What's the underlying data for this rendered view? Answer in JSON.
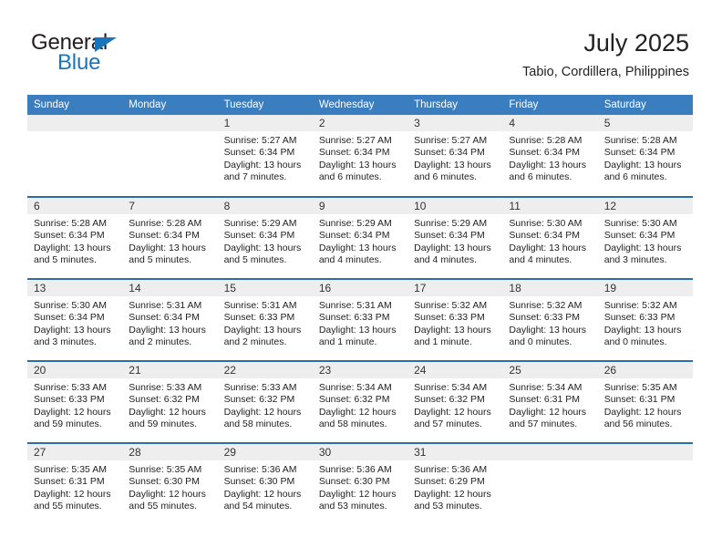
{
  "brand": {
    "name_part1": "General",
    "name_part2": "Blue",
    "logo_icon": "triangle-logo-icon",
    "accent_color": "#1b75bc"
  },
  "header": {
    "title": "July 2025",
    "subtitle": "Tabio, Cordillera, Philippines"
  },
  "theme": {
    "header_bar_color": "#3a7ebf",
    "row_divider_color": "#2e6da4",
    "daynum_band_color": "#eeeeee"
  },
  "weekdays": [
    "Sunday",
    "Monday",
    "Tuesday",
    "Wednesday",
    "Thursday",
    "Friday",
    "Saturday"
  ],
  "weeks": [
    [
      {
        "day": "",
        "sunrise": "",
        "sunset": "",
        "daylight1": "",
        "daylight2": "",
        "empty": true
      },
      {
        "day": "",
        "sunrise": "",
        "sunset": "",
        "daylight1": "",
        "daylight2": "",
        "empty": true
      },
      {
        "day": "1",
        "sunrise": "Sunrise: 5:27 AM",
        "sunset": "Sunset: 6:34 PM",
        "daylight1": "Daylight: 13 hours",
        "daylight2": "and 7 minutes."
      },
      {
        "day": "2",
        "sunrise": "Sunrise: 5:27 AM",
        "sunset": "Sunset: 6:34 PM",
        "daylight1": "Daylight: 13 hours",
        "daylight2": "and 6 minutes."
      },
      {
        "day": "3",
        "sunrise": "Sunrise: 5:27 AM",
        "sunset": "Sunset: 6:34 PM",
        "daylight1": "Daylight: 13 hours",
        "daylight2": "and 6 minutes."
      },
      {
        "day": "4",
        "sunrise": "Sunrise: 5:28 AM",
        "sunset": "Sunset: 6:34 PM",
        "daylight1": "Daylight: 13 hours",
        "daylight2": "and 6 minutes."
      },
      {
        "day": "5",
        "sunrise": "Sunrise: 5:28 AM",
        "sunset": "Sunset: 6:34 PM",
        "daylight1": "Daylight: 13 hours",
        "daylight2": "and 6 minutes."
      }
    ],
    [
      {
        "day": "6",
        "sunrise": "Sunrise: 5:28 AM",
        "sunset": "Sunset: 6:34 PM",
        "daylight1": "Daylight: 13 hours",
        "daylight2": "and 5 minutes."
      },
      {
        "day": "7",
        "sunrise": "Sunrise: 5:28 AM",
        "sunset": "Sunset: 6:34 PM",
        "daylight1": "Daylight: 13 hours",
        "daylight2": "and 5 minutes."
      },
      {
        "day": "8",
        "sunrise": "Sunrise: 5:29 AM",
        "sunset": "Sunset: 6:34 PM",
        "daylight1": "Daylight: 13 hours",
        "daylight2": "and 5 minutes."
      },
      {
        "day": "9",
        "sunrise": "Sunrise: 5:29 AM",
        "sunset": "Sunset: 6:34 PM",
        "daylight1": "Daylight: 13 hours",
        "daylight2": "and 4 minutes."
      },
      {
        "day": "10",
        "sunrise": "Sunrise: 5:29 AM",
        "sunset": "Sunset: 6:34 PM",
        "daylight1": "Daylight: 13 hours",
        "daylight2": "and 4 minutes."
      },
      {
        "day": "11",
        "sunrise": "Sunrise: 5:30 AM",
        "sunset": "Sunset: 6:34 PM",
        "daylight1": "Daylight: 13 hours",
        "daylight2": "and 4 minutes."
      },
      {
        "day": "12",
        "sunrise": "Sunrise: 5:30 AM",
        "sunset": "Sunset: 6:34 PM",
        "daylight1": "Daylight: 13 hours",
        "daylight2": "and 3 minutes."
      }
    ],
    [
      {
        "day": "13",
        "sunrise": "Sunrise: 5:30 AM",
        "sunset": "Sunset: 6:34 PM",
        "daylight1": "Daylight: 13 hours",
        "daylight2": "and 3 minutes."
      },
      {
        "day": "14",
        "sunrise": "Sunrise: 5:31 AM",
        "sunset": "Sunset: 6:34 PM",
        "daylight1": "Daylight: 13 hours",
        "daylight2": "and 2 minutes."
      },
      {
        "day": "15",
        "sunrise": "Sunrise: 5:31 AM",
        "sunset": "Sunset: 6:33 PM",
        "daylight1": "Daylight: 13 hours",
        "daylight2": "and 2 minutes."
      },
      {
        "day": "16",
        "sunrise": "Sunrise: 5:31 AM",
        "sunset": "Sunset: 6:33 PM",
        "daylight1": "Daylight: 13 hours",
        "daylight2": "and 1 minute."
      },
      {
        "day": "17",
        "sunrise": "Sunrise: 5:32 AM",
        "sunset": "Sunset: 6:33 PM",
        "daylight1": "Daylight: 13 hours",
        "daylight2": "and 1 minute."
      },
      {
        "day": "18",
        "sunrise": "Sunrise: 5:32 AM",
        "sunset": "Sunset: 6:33 PM",
        "daylight1": "Daylight: 13 hours",
        "daylight2": "and 0 minutes."
      },
      {
        "day": "19",
        "sunrise": "Sunrise: 5:32 AM",
        "sunset": "Sunset: 6:33 PM",
        "daylight1": "Daylight: 13 hours",
        "daylight2": "and 0 minutes."
      }
    ],
    [
      {
        "day": "20",
        "sunrise": "Sunrise: 5:33 AM",
        "sunset": "Sunset: 6:33 PM",
        "daylight1": "Daylight: 12 hours",
        "daylight2": "and 59 minutes."
      },
      {
        "day": "21",
        "sunrise": "Sunrise: 5:33 AM",
        "sunset": "Sunset: 6:32 PM",
        "daylight1": "Daylight: 12 hours",
        "daylight2": "and 59 minutes."
      },
      {
        "day": "22",
        "sunrise": "Sunrise: 5:33 AM",
        "sunset": "Sunset: 6:32 PM",
        "daylight1": "Daylight: 12 hours",
        "daylight2": "and 58 minutes."
      },
      {
        "day": "23",
        "sunrise": "Sunrise: 5:34 AM",
        "sunset": "Sunset: 6:32 PM",
        "daylight1": "Daylight: 12 hours",
        "daylight2": "and 58 minutes."
      },
      {
        "day": "24",
        "sunrise": "Sunrise: 5:34 AM",
        "sunset": "Sunset: 6:32 PM",
        "daylight1": "Daylight: 12 hours",
        "daylight2": "and 57 minutes."
      },
      {
        "day": "25",
        "sunrise": "Sunrise: 5:34 AM",
        "sunset": "Sunset: 6:31 PM",
        "daylight1": "Daylight: 12 hours",
        "daylight2": "and 57 minutes."
      },
      {
        "day": "26",
        "sunrise": "Sunrise: 5:35 AM",
        "sunset": "Sunset: 6:31 PM",
        "daylight1": "Daylight: 12 hours",
        "daylight2": "and 56 minutes."
      }
    ],
    [
      {
        "day": "27",
        "sunrise": "Sunrise: 5:35 AM",
        "sunset": "Sunset: 6:31 PM",
        "daylight1": "Daylight: 12 hours",
        "daylight2": "and 55 minutes."
      },
      {
        "day": "28",
        "sunrise": "Sunrise: 5:35 AM",
        "sunset": "Sunset: 6:30 PM",
        "daylight1": "Daylight: 12 hours",
        "daylight2": "and 55 minutes."
      },
      {
        "day": "29",
        "sunrise": "Sunrise: 5:36 AM",
        "sunset": "Sunset: 6:30 PM",
        "daylight1": "Daylight: 12 hours",
        "daylight2": "and 54 minutes."
      },
      {
        "day": "30",
        "sunrise": "Sunrise: 5:36 AM",
        "sunset": "Sunset: 6:30 PM",
        "daylight1": "Daylight: 12 hours",
        "daylight2": "and 53 minutes."
      },
      {
        "day": "31",
        "sunrise": "Sunrise: 5:36 AM",
        "sunset": "Sunset: 6:29 PM",
        "daylight1": "Daylight: 12 hours",
        "daylight2": "and 53 minutes."
      },
      {
        "day": "",
        "sunrise": "",
        "sunset": "",
        "daylight1": "",
        "daylight2": "",
        "empty": true
      },
      {
        "day": "",
        "sunrise": "",
        "sunset": "",
        "daylight1": "",
        "daylight2": "",
        "empty": true
      }
    ]
  ]
}
